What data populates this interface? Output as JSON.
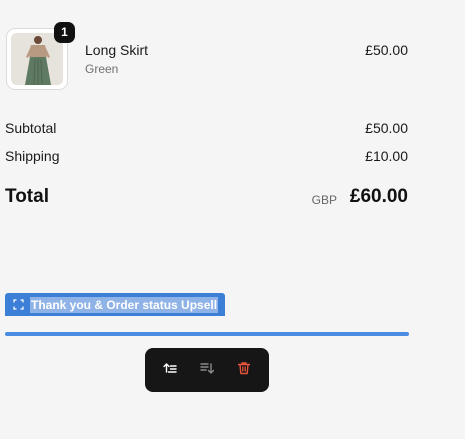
{
  "line_item": {
    "quantity": "1",
    "name": "Long Skirt",
    "variant": "Green",
    "price": "£50.00"
  },
  "summary": {
    "subtotal_label": "Subtotal",
    "subtotal_value": "£50.00",
    "shipping_label": "Shipping",
    "shipping_value": "£10.00",
    "total_label": "Total",
    "currency": "GBP",
    "total_value": "£60.00"
  },
  "editor": {
    "section_label": "Thank you & Order status Upsell",
    "toolbar": {
      "move_up_icon": "move-up-icon",
      "move_down_icon": "move-down-icon",
      "delete_icon": "trash-icon"
    }
  },
  "colors": {
    "selection": "#4b8ce3",
    "toolbar_bg": "#161616",
    "delete": "#e5533d"
  }
}
